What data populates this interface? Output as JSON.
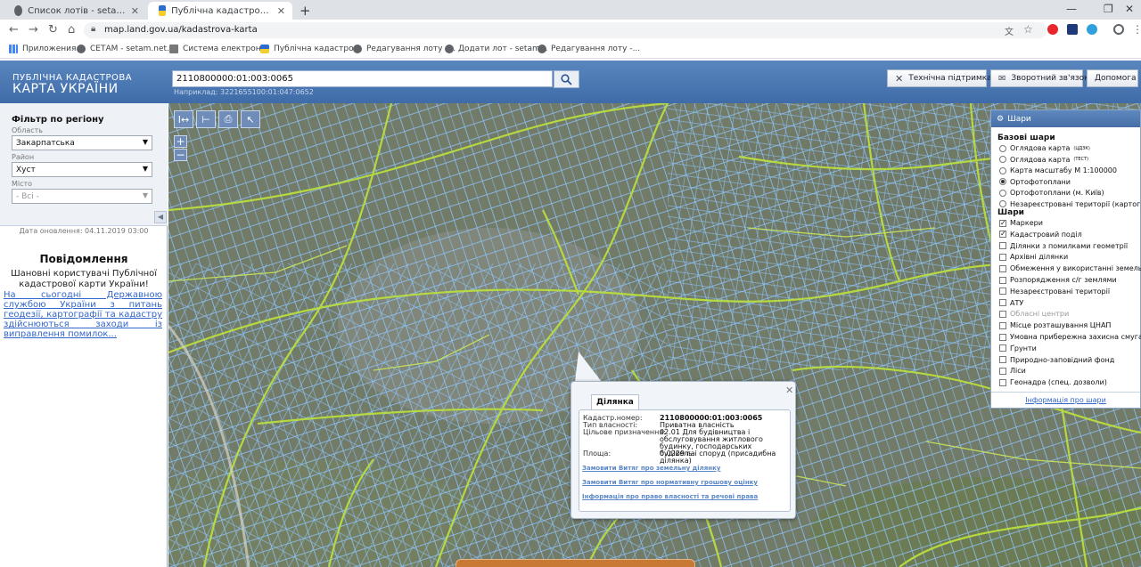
{
  "browser": {
    "tabs": [
      {
        "title": "Список лотів - setam.net.ua",
        "active": false
      },
      {
        "title": "Публічна кадастрова карта Укр",
        "active": true
      }
    ],
    "url": "map.land.gov.ua/kadastrova-karta",
    "bookmarks": [
      "Приложения",
      "СЕТАМ - setam.net....",
      "Система електрон...",
      "Публічна кадастро...",
      "Редагування лоту -...",
      "Додати лот - setam...",
      "Редагування лоту -..."
    ]
  },
  "header": {
    "logo_line1": "ПУБЛІЧНА КАДАСТРОВА",
    "logo_line2": "КАРТА УКРАЇНИ",
    "search_value": "2110800000:01:003:0065",
    "search_hint": "Наприклад: 3221655100:01:047:0652",
    "buttons": {
      "support": "Технічна підтримка",
      "feedback": "Зворотний зв'язок",
      "help": "Допомога"
    }
  },
  "filter": {
    "title": "Фільтр по регіону",
    "region_label": "Область",
    "region_value": "Закарпатська",
    "district_label": "Район",
    "district_value": "Хуст",
    "city_label": "Місто",
    "city_value": "- Всі -"
  },
  "notice": {
    "updated": "Дата оновлення: 04.11.2019 03:00",
    "title": "Повідомлення",
    "text": "Шановні користувачі Публічної кадастрової карти України!",
    "link": "На сьогодні Державною службою України з питань геодезії, картографії та кадастру здійснюються заходи із виправлення помилок..."
  },
  "layers": {
    "title": "Шари",
    "base_title": "Базові шари",
    "base": [
      {
        "label": "Оглядова карта",
        "sup": "(ЦДЗК)",
        "on": false
      },
      {
        "label": "Оглядова карта",
        "sup": "(ТЕСТ)",
        "on": false
      },
      {
        "label": "Карта масштабу М 1:100000",
        "sup": "",
        "on": false
      },
      {
        "label": "Ортофотоплани",
        "sup": "",
        "on": true
      },
      {
        "label": "Ортофотоплани (м. Київ)",
        "sup": "",
        "on": false
      },
      {
        "label": "Незареєстровані території (картограма)",
        "sup": "",
        "on": false
      }
    ],
    "layers_title": "Шари",
    "items": [
      {
        "label": "Маркери",
        "checked": true,
        "disabled": false
      },
      {
        "label": "Кадастровий поділ",
        "checked": true,
        "disabled": false
      },
      {
        "label": "Ділянки з помилками геометрії",
        "checked": false,
        "disabled": false
      },
      {
        "label": "Архівні ділянки",
        "checked": false,
        "disabled": false
      },
      {
        "label": "Обмеження у використанні земель",
        "checked": false,
        "disabled": false
      },
      {
        "label": "Розпорядження с/г землями",
        "checked": false,
        "disabled": false
      },
      {
        "label": "Незареєстровані території",
        "checked": false,
        "disabled": false
      },
      {
        "label": "АТУ",
        "checked": false,
        "disabled": false
      },
      {
        "label": "Обласні центри",
        "checked": false,
        "disabled": true
      },
      {
        "label": "Місце розташування ЦНАП",
        "checked": false,
        "disabled": false
      },
      {
        "label": "Умовна прибережна захисна смуга",
        "checked": false,
        "disabled": false
      },
      {
        "label": "Ґрунти",
        "checked": false,
        "disabled": false
      },
      {
        "label": "Природно-заповідний фонд",
        "checked": false,
        "disabled": false
      },
      {
        "label": "Ліси",
        "checked": false,
        "disabled": false
      },
      {
        "label": "Геонадра (спец. дозволи)",
        "checked": false,
        "disabled": false
      }
    ],
    "footer_link": "Інформація про шари"
  },
  "popup": {
    "tab": "Ділянка",
    "rows": [
      {
        "label": "Кадастр.номер:",
        "value": "2110800000:01:003:0065"
      },
      {
        "label": "Тип власності:",
        "value": "Приватна власність"
      },
      {
        "label": "Цільове призначення:",
        "value": "02.01 Для будівництва і обслуговування житлового будинку, господарських будівель і споруд (присадибна ділянка)"
      },
      {
        "label": "Площа:",
        "value": "0.0229 га"
      }
    ],
    "links": [
      "Замовити Витяг про земельну ділянку",
      "Замовити Витяг про нормативну грошову оцінку",
      "Інформація про право власності та речові права"
    ]
  },
  "icons": {
    "search": "magnifier-icon",
    "support": "tools-icon",
    "feedback": "envelope-icon",
    "layers": "gear-icon",
    "close": "close-icon"
  },
  "colors": {
    "header_blue": "#4a78b2",
    "parcel_blue": "#8ec7ff",
    "road_green": "#b9de3e",
    "link_blue": "#3366cc"
  }
}
